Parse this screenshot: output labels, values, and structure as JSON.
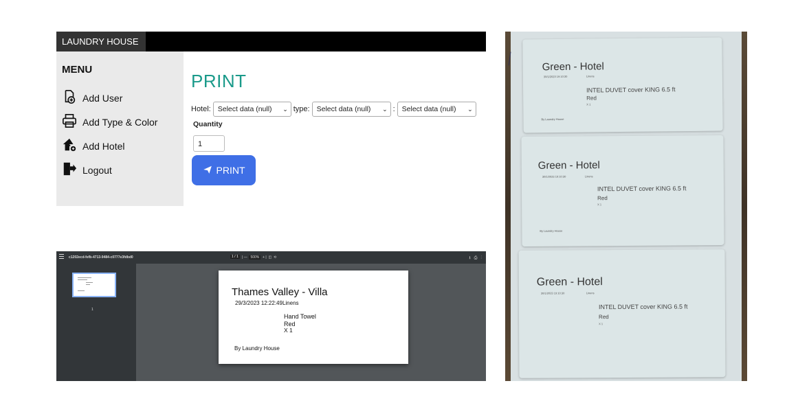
{
  "app": {
    "brand": "LAUNDRY HOUSE",
    "menu_title": "MENU",
    "menu": [
      {
        "label": "Add User",
        "icon": "add-user-icon"
      },
      {
        "label": "Add Type & Color",
        "icon": "printer-icon"
      },
      {
        "label": "Add Hotel",
        "icon": "add-hotel-icon"
      },
      {
        "label": "Logout",
        "icon": "logout-icon"
      }
    ],
    "page_title": "PRINT",
    "hotel_label": "Hotel:",
    "hotel_select": "Select data (null)",
    "type_label": "type:",
    "type_select": "Select data (null)",
    "sep_label": ":",
    "color_select": "Select data (null)",
    "quantity_label": "Quantity",
    "quantity_value": "1",
    "print_button": "PRINT",
    "accent_color": "#1a9a8a",
    "button_color": "#3f6fe6"
  },
  "pdf": {
    "filename": "c1202ecd-fefb-4713-9484-c0777e3fdbd0",
    "page_indicator": "1 / 1",
    "zoom": "500%",
    "thumb_number": "1",
    "label": {
      "title": "Thames Valley - Villa",
      "datetime": "29/3/2023 12:22:49Linens",
      "item": "Hand Towel",
      "color": "Red",
      "qty": "X 1",
      "footer": "By Laundry House"
    }
  },
  "photo": {
    "labels": [
      {
        "title": "Green  - Hotel",
        "date": "30/1/2023 19:10:30",
        "cat": "Linens",
        "item": "INTEL DUVET cover KING 6.5 ft",
        "color": "Red",
        "qty": "X 1",
        "footer": "By Laundry House"
      },
      {
        "title": "Green  - Hotel",
        "date": "30/1/2023 19:10:30",
        "cat": "Linens",
        "item": "INTEL DUVET cover KING 6.5 ft",
        "color": "Red",
        "qty": "X 1",
        "footer": "By Laundry House"
      },
      {
        "title": "Green  - Hotel",
        "date": "30/1/2023 19:10:30",
        "cat": "Linens",
        "item": "INTEL DUVET cover KING 6.5 ft",
        "color": "Red",
        "qty": "X 1",
        "footer": ""
      }
    ]
  }
}
